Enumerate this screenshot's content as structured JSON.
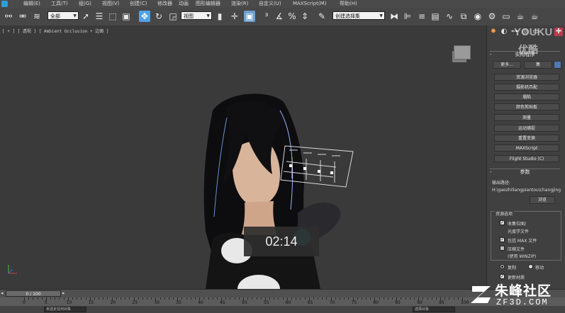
{
  "menu": {
    "items": [
      "编辑(E)",
      "工具(T)",
      "组(G)",
      "视图(V)",
      "创建(C)",
      "修改器",
      "动画",
      "图形编辑器",
      "渲染(R)",
      "自定义(U)",
      "MAXScript(M)",
      "帮助(H)"
    ]
  },
  "toolbar": {
    "filter_select": "全部",
    "view_select": "视图",
    "named_selection": "创建选择集"
  },
  "viewport": {
    "label": "[ + ] [ 透视 ] [ Ambient Occlusion + 边面 ]",
    "timer": "02:14"
  },
  "command_panel": {
    "utility_title": "实用程序",
    "more_label": "更多...",
    "sets_label": "集",
    "utilities": [
      "资源浏览器",
      "摄影机匹配",
      "塌陷",
      "颜色剪贴板",
      "测量",
      "运动捕捉",
      "重置变换",
      "MAXScript",
      "Flight Studio (C)"
    ],
    "params_title": "参数",
    "output_path_label": "输出路径:",
    "output_path_value": "H:\\gaozhiliangpiantou\\changjing",
    "browse_label": "浏览",
    "resource_group_title": "资源选项",
    "opt_collect_maps": "收集位图/",
    "opt_photometric": "光度学文件",
    "opt_include_max": "包括 MAX 文件",
    "opt_compress": "压缩文件",
    "opt_winzip": "(使用 WINZIP)",
    "radio_copy": "复制",
    "radio_move": "移动",
    "opt_update_materials": "更新材质"
  },
  "timeline": {
    "frame_label": "0 / 100",
    "ticks": [
      "0",
      "5",
      "10",
      "15",
      "20",
      "25",
      "30",
      "35",
      "40",
      "45",
      "50",
      "55",
      "60",
      "65",
      "70",
      "75",
      "80",
      "85",
      "90",
      "95",
      "100"
    ]
  },
  "status": {
    "prompt": "未选定任何对象",
    "selection": "选择对象"
  },
  "watermarks": {
    "youku_en": "YOUKU",
    "youku_cn": "优酷",
    "zf_cn": "朱峰社区",
    "zf_en": "ZF3D.COM"
  }
}
